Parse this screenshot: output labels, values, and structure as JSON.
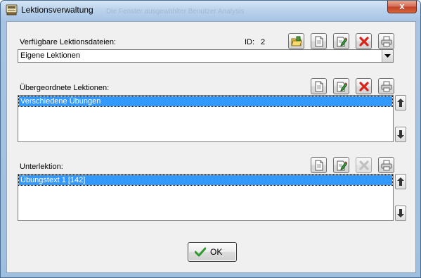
{
  "window": {
    "title": "Lektionsverwaltung",
    "ghost_title": "Die Fenster ausgewählter Benutzer Analysis",
    "close_glyph": "x"
  },
  "files": {
    "label": "Verfügbare Lektionsdateien:",
    "id_label": "ID:",
    "id_value": "2",
    "selected": "Eigene Lektionen",
    "toolbar": [
      "open-folder-icon",
      "new-document-icon",
      "edit-document-icon",
      "delete-icon",
      "print-icon"
    ]
  },
  "parent": {
    "label": "Übergeordnete Lektionen:",
    "items": [
      "Verschiedene Übungen"
    ],
    "toolbar": [
      "new-document-icon",
      "edit-document-icon",
      "delete-icon",
      "print-icon"
    ]
  },
  "sub": {
    "label": "Unterlektion:",
    "items": [
      "Übungstext 1 [142]"
    ],
    "toolbar": [
      "new-document-icon",
      "edit-document-icon",
      "delete-icon-disabled",
      "print-icon"
    ]
  },
  "ok_button": {
    "label": "OK"
  },
  "colors": {
    "selection": "#3399ff",
    "delete_red": "#d9221a",
    "ok_check_green": "#2e9a2e"
  }
}
